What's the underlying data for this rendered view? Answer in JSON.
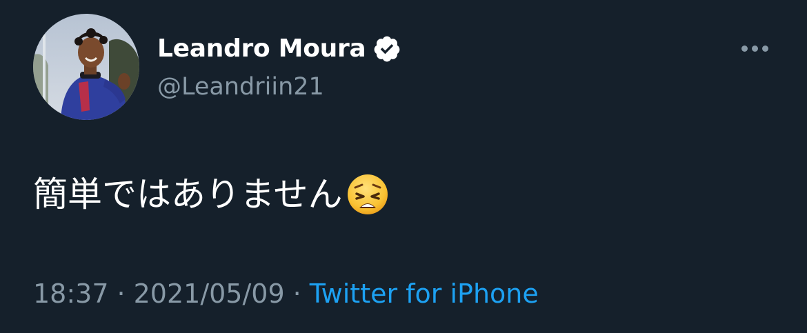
{
  "tweet": {
    "author": {
      "display_name": "Leandro Moura",
      "handle": "@Leandriin21",
      "verified": true,
      "avatar_icon": "profile-photo"
    },
    "text": "簡単ではありません",
    "emoji": "weary-face",
    "time": "18:37",
    "separator": "·",
    "date": "2021/05/09",
    "source": "Twitter for iPhone"
  },
  "colors": {
    "background": "#15202b",
    "primary_text": "#ffffff",
    "secondary_text": "#8899a6",
    "link": "#1da1f2"
  }
}
